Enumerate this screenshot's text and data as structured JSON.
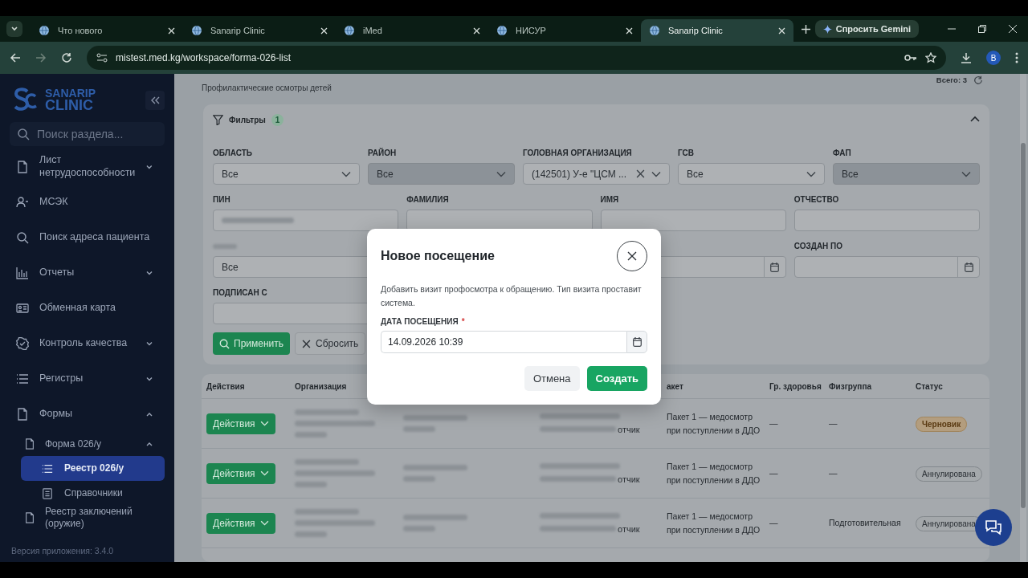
{
  "browser": {
    "tabs": [
      {
        "title": "Что нового",
        "selected": false
      },
      {
        "title": "Sanarip Clinic",
        "selected": false
      },
      {
        "title": "iMed",
        "selected": false
      },
      {
        "title": "НИСУР",
        "selected": false
      },
      {
        "title": "Sanarip Clinic",
        "selected": true
      }
    ],
    "gemini": "Спросить Gemini",
    "url": "mistest.med.kg/workspace/forma-026-list",
    "profile": "B"
  },
  "sidebar": {
    "logo_top": "SANARIP",
    "logo_bottom": "CLINIC",
    "search": {
      "placeholder": "Поиск раздела..."
    },
    "items": [
      {
        "label": "Лист нетрудоспособности",
        "expanded": false
      },
      {
        "label": "МСЭК"
      },
      {
        "label": "Поиск адреса пациента"
      },
      {
        "label": "Отчеты",
        "expanded": false
      },
      {
        "label": "Обменная карта"
      },
      {
        "label": "Контроль качества",
        "expanded": false
      },
      {
        "label": "Регистры",
        "expanded": false
      },
      {
        "label": "Формы",
        "expanded": true,
        "children": [
          {
            "label": "Форма 026/у",
            "expanded": true,
            "children": [
              {
                "label": "Реестр 026/у",
                "selected": true
              },
              {
                "label": "Справочники",
                "selected": false
              }
            ]
          },
          {
            "label": "Реестр заключений (оружие)"
          }
        ]
      }
    ],
    "version": "Версия приложения: 3.4.0"
  },
  "page": {
    "subtitle": "Профилактические осмотры детей",
    "total": "Всего: 3"
  },
  "filters": {
    "title": "Фильтры",
    "count": "1",
    "expanded": true,
    "row_1": [
      {
        "label": "ОБЛАСТЬ",
        "value": "Все",
        "disabled": false
      },
      {
        "label": "РАЙОН",
        "value": "Все",
        "disabled": true
      },
      {
        "label": "ГОЛОВНАЯ ОРГАНИЗАЦИЯ",
        "value": "(142501) У-е \"ЦСМ ...",
        "disabled": false,
        "clearable": true
      },
      {
        "label": "ГСВ",
        "value": "Все",
        "disabled": false
      },
      {
        "label": "ФАП",
        "value": "Все",
        "disabled": true
      }
    ],
    "row_2": [
      {
        "label": "ПИН",
        "obscured": true
      },
      {
        "label": "ФАМИЛИЯ",
        "obscured": false
      },
      {
        "label": "ИМЯ",
        "obscured": false
      },
      {
        "label": "ОТЧЕСТВО",
        "obscured": false
      }
    ],
    "row_3": [
      {
        "kind": "select",
        "value": "Все"
      },
      {
        "kind": "hidden"
      },
      {
        "kind": "date"
      },
      {
        "kind": "date",
        "label": "СОЗДАН ПО"
      }
    ],
    "signed_from": {
      "label": "ПОДПИСАН С"
    },
    "apply": "Применить",
    "reset": "Сбросить"
  },
  "table": {
    "columns": [
      "Действия",
      "Организация",
      "акет",
      "Гр. здоровья",
      "Физгруппа",
      "Статус"
    ],
    "rows": [
      {
        "action": "Действия",
        "column_4": "отчик",
        "package": "Пакет 1 — медосмотр при поступлении в ДДО",
        "health_group": "—",
        "phys_group": "—",
        "status": "Черновик",
        "kind": "draft"
      },
      {
        "action": "Действия",
        "column_4": "отчик",
        "package": "Пакет 1 — медосмотр при поступлении в ДДО",
        "health_group": "—",
        "phys_group": "—",
        "status": "Аннулирована",
        "kind": "cancelled"
      },
      {
        "action": "Действия",
        "column_4": "отчик",
        "package": "Пакет 1 — медосмотр при поступлении в ДДО",
        "health_group": "—",
        "phys_group": "Подготовительная",
        "status": "Аннулирована",
        "kind": "cancelled"
      }
    ]
  },
  "modal": {
    "title": "Новое посещение",
    "text": "Добавить визит профосмотра к обращению. Тип визита проставит система.",
    "field_label": "ДАТА ПОСЕЩЕНИЯ",
    "required_mark": "*",
    "value": "14.09.2026 10:39",
    "cancel": "Отмена",
    "submit": "Создать"
  }
}
